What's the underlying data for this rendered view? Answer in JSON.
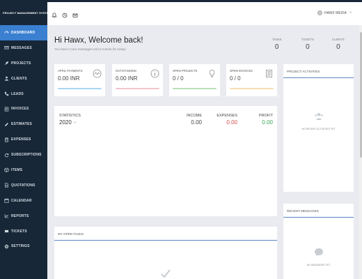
{
  "brand": "PROJECT MANAGEMENT SYSTEM",
  "nav": [
    {
      "label": "DASHBOARD",
      "icon": "dashboard-icon",
      "active": true
    },
    {
      "label": "MESSAGES",
      "icon": "messages-icon"
    },
    {
      "label": "PROJECTS",
      "icon": "rocket-icon"
    },
    {
      "label": "CLIENTS",
      "icon": "user-icon"
    },
    {
      "label": "LEADS",
      "icon": "phone-icon"
    },
    {
      "label": "INVOICES",
      "icon": "invoice-icon"
    },
    {
      "label": "ESTIMATES",
      "icon": "edit-icon"
    },
    {
      "label": "EXPENSES",
      "icon": "calculator-icon"
    },
    {
      "label": "SUBSCRIPTIONS",
      "icon": "refresh-icon"
    },
    {
      "label": "ITEMS",
      "icon": "box-icon"
    },
    {
      "label": "QUOTATIONS",
      "icon": "document-icon"
    },
    {
      "label": "CALENDAR",
      "icon": "calendar-icon"
    },
    {
      "label": "REPORTS",
      "icon": "chart-icon"
    },
    {
      "label": "TICKETS",
      "icon": "ticket-icon"
    },
    {
      "label": "SETTINGS",
      "icon": "gear-icon"
    }
  ],
  "topbar": {
    "user_name": "HAWX MEDIA"
  },
  "welcome": {
    "title": "Hi Hawx, Welcome back!",
    "subtitle": "You have 0 new messages and 0 events for today!"
  },
  "header_stats": [
    {
      "label": "TASKS",
      "value": "0"
    },
    {
      "label": "TICKETS",
      "value": "0"
    },
    {
      "label": "CLIENTS",
      "value": "0"
    }
  ],
  "cards": [
    {
      "title": "APRIL PAYMENTS",
      "value": "0.00 INR",
      "color": "#a9d6f5",
      "icon": "wave-icon"
    },
    {
      "title": "OUTSTANDING",
      "value": "0.00 INR",
      "color": "#f3c4cc",
      "icon": "info-icon"
    },
    {
      "title": "OPEN PROJECTS",
      "value": "0 / 0",
      "color": "#b8e0b8",
      "icon": "lightbulb-icon"
    },
    {
      "title": "OPEN INVOICES",
      "value": "0 / 0",
      "color": "#f6ddb3",
      "icon": "receipt-icon"
    }
  ],
  "finance": {
    "statistics_label": "STATISTICS",
    "year": "2020",
    "income_label": "INCOME",
    "income_value": "0.00",
    "expenses_label": "EXPENSES",
    "expenses_value": "0.00",
    "profit_label": "PROFIT",
    "profit_value": "0.00",
    "expenses_color": "#d9534f",
    "profit_color": "#3aa655"
  },
  "project_activities": {
    "title": "PROJECT ACTIVITIES",
    "empty": "NO RECENT ACTIVITIES YET"
  },
  "recent_messages": {
    "title": "RECENT MESSAGES",
    "empty": "NO MESSAGES YET"
  },
  "open_tasks": {
    "title": "MY OPEN TASKS"
  }
}
